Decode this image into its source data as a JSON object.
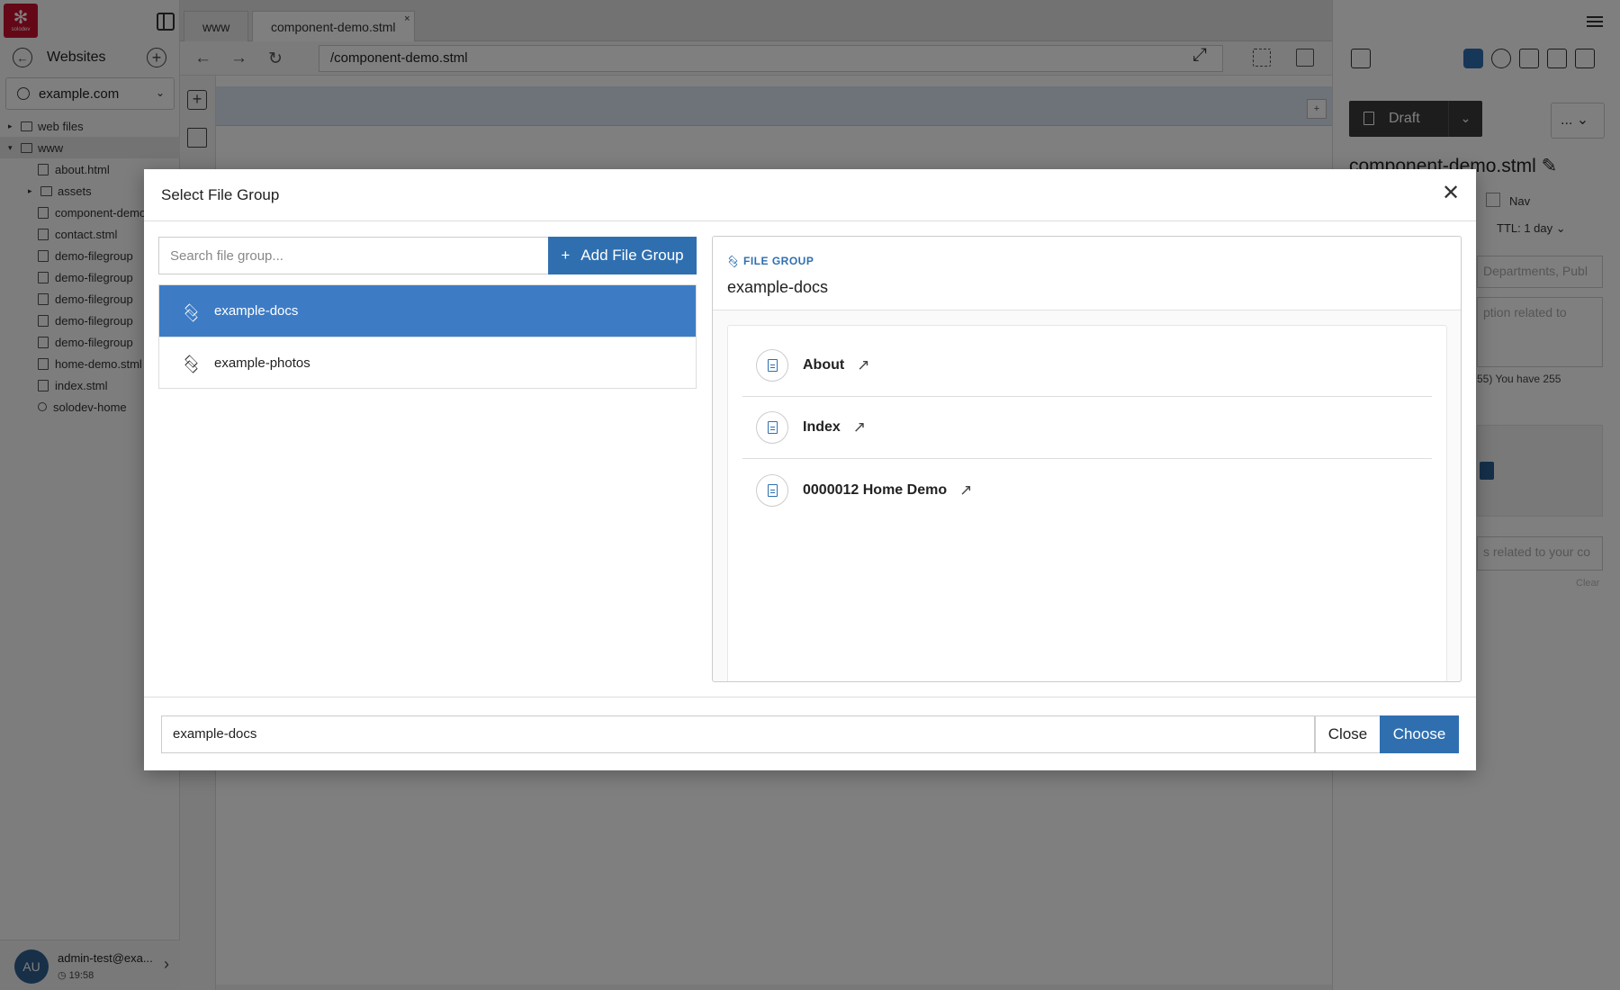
{
  "app": {
    "logo_text": "solodev",
    "sites_title": "Websites",
    "site_selected": "example.com",
    "tree": [
      {
        "label": "web files"
      },
      {
        "label": "www"
      },
      {
        "label": "about.html"
      },
      {
        "label": "assets"
      },
      {
        "label": "component-demo.stml"
      },
      {
        "label": "contact.stml"
      },
      {
        "label": "demo-filegroup"
      },
      {
        "label": "demo-filegroup"
      },
      {
        "label": "demo-filegroup"
      },
      {
        "label": "demo-filegroup"
      },
      {
        "label": "demo-filegroup"
      },
      {
        "label": "home-demo.stml"
      },
      {
        "label": "index.stml"
      },
      {
        "label": "solodev-home"
      }
    ],
    "user": {
      "initials": "AU",
      "name": "admin-test@exa...",
      "time": "19:58"
    }
  },
  "center": {
    "tabs": [
      {
        "label": "www"
      },
      {
        "label": "component-demo.stml"
      }
    ],
    "tab_close": "×",
    "url": "/component-demo.stml",
    "strip_mini": "+"
  },
  "right_panel": {
    "status_label": "Draft",
    "more_label": "...",
    "page_title": "component-demo.stml",
    "nav_label": "Nav",
    "ttl_label": "TTL: 1 day",
    "tags_placeholder": "Departments, Publ",
    "desc_placeholder": "ption related to",
    "char_note": "55) You have 255",
    "keywords_placeholder": "s related to your co",
    "clear_label": "Clear"
  },
  "modal": {
    "title": "Select File Group",
    "search_placeholder": "Search file group...",
    "add_button_label": "Add File Group",
    "groups": [
      {
        "label": "example-docs",
        "active": true
      },
      {
        "label": "example-photos",
        "active": false
      }
    ],
    "detail": {
      "section_label": "FILE GROUP",
      "name": "example-docs",
      "files": [
        {
          "title": "About"
        },
        {
          "title": "Index"
        },
        {
          "title": "0000012 Home Demo"
        }
      ]
    },
    "selected_value": "example-docs",
    "close_label": "Close",
    "choose_label": "Choose"
  },
  "colors": {
    "accent": "#2f6fb0",
    "active_item": "#3d7cc5",
    "brand": "#c8102e",
    "overlay": "rgba(0,0,0,0.5)"
  }
}
